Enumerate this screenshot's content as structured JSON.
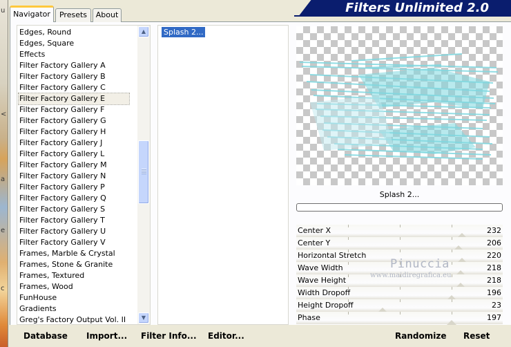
{
  "app": {
    "title": "Filters Unlimited 2.0"
  },
  "tabs": [
    {
      "label": "Navigator",
      "active": true
    },
    {
      "label": "Presets",
      "active": false
    },
    {
      "label": "About",
      "active": false
    }
  ],
  "categories": {
    "items": [
      "Edges, Round",
      "Edges, Square",
      "Effects",
      "Filter Factory Gallery A",
      "Filter Factory Gallery B",
      "Filter Factory Gallery C",
      "Filter Factory Gallery E",
      "Filter Factory Gallery F",
      "Filter Factory Gallery G",
      "Filter Factory Gallery H",
      "Filter Factory Gallery J",
      "Filter Factory Gallery L",
      "Filter Factory Gallery M",
      "Filter Factory Gallery N",
      "Filter Factory Gallery P",
      "Filter Factory Gallery Q",
      "Filter Factory Gallery S",
      "Filter Factory Gallery T",
      "Filter Factory Gallery U",
      "Filter Factory Gallery V",
      "Frames, Marble & Crystal",
      "Frames, Stone & Granite",
      "Frames, Textured",
      "Frames, Wood",
      "FunHouse",
      "Gradients",
      "Greg's Factory Output Vol. II"
    ],
    "selected": "Filter Factory Gallery E"
  },
  "filters": {
    "items": [
      "Splash 2..."
    ],
    "selected": "Splash 2..."
  },
  "preview": {
    "name": "Splash 2...",
    "progress": 0,
    "accent_color": "#7fd8e0"
  },
  "params": [
    {
      "label": "Center X",
      "value": "232"
    },
    {
      "label": "Center Y",
      "value": "206"
    },
    {
      "label": "Horizontal Stretch",
      "value": "220"
    },
    {
      "label": "Wave Width",
      "value": "218"
    },
    {
      "label": "Wave Height",
      "value": "218"
    },
    {
      "label": "Width Dropoff",
      "value": "196"
    },
    {
      "label": "Height Dropoff",
      "value": "23"
    },
    {
      "label": "Phase",
      "value": "197"
    }
  ],
  "watermark": {
    "name": "Pinuccia",
    "url": "www.maidiregrafica.eu"
  },
  "buttons": {
    "database": "Database",
    "import": "Import...",
    "filter_info": "Filter Info...",
    "editor": "Editor...",
    "randomize": "Randomize",
    "reset": "Reset"
  },
  "left_strip_chars": [
    "u",
    "<",
    "a",
    "e",
    "c"
  ]
}
